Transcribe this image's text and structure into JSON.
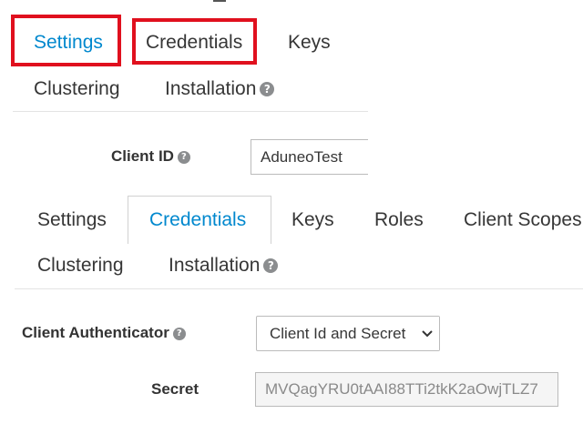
{
  "top_tabs": {
    "settings": "Settings",
    "credentials": "Credentials",
    "keys": "Keys",
    "clustering": "Clustering",
    "installation": "Installation"
  },
  "client_id": {
    "label": "Client ID",
    "value": "AduneoTest"
  },
  "client_tabs": {
    "settings": "Settings",
    "credentials": "Credentials",
    "keys": "Keys",
    "roles": "Roles",
    "client_scopes": "Client Scopes",
    "clustering": "Clustering",
    "installation": "Installation"
  },
  "client_authenticator": {
    "label": "Client Authenticator",
    "selected": "Client Id and Secret"
  },
  "secret": {
    "label": "Secret",
    "value": "MVQagYRU0tAAI88TTi2tkK2aOwjTLZ7"
  },
  "help_glyph": "?",
  "chevron_glyph": "⌄",
  "colors": {
    "active_tab": "#0088ce",
    "highlight_box": "#e0101e",
    "help_icon": "#8b8d8f"
  }
}
